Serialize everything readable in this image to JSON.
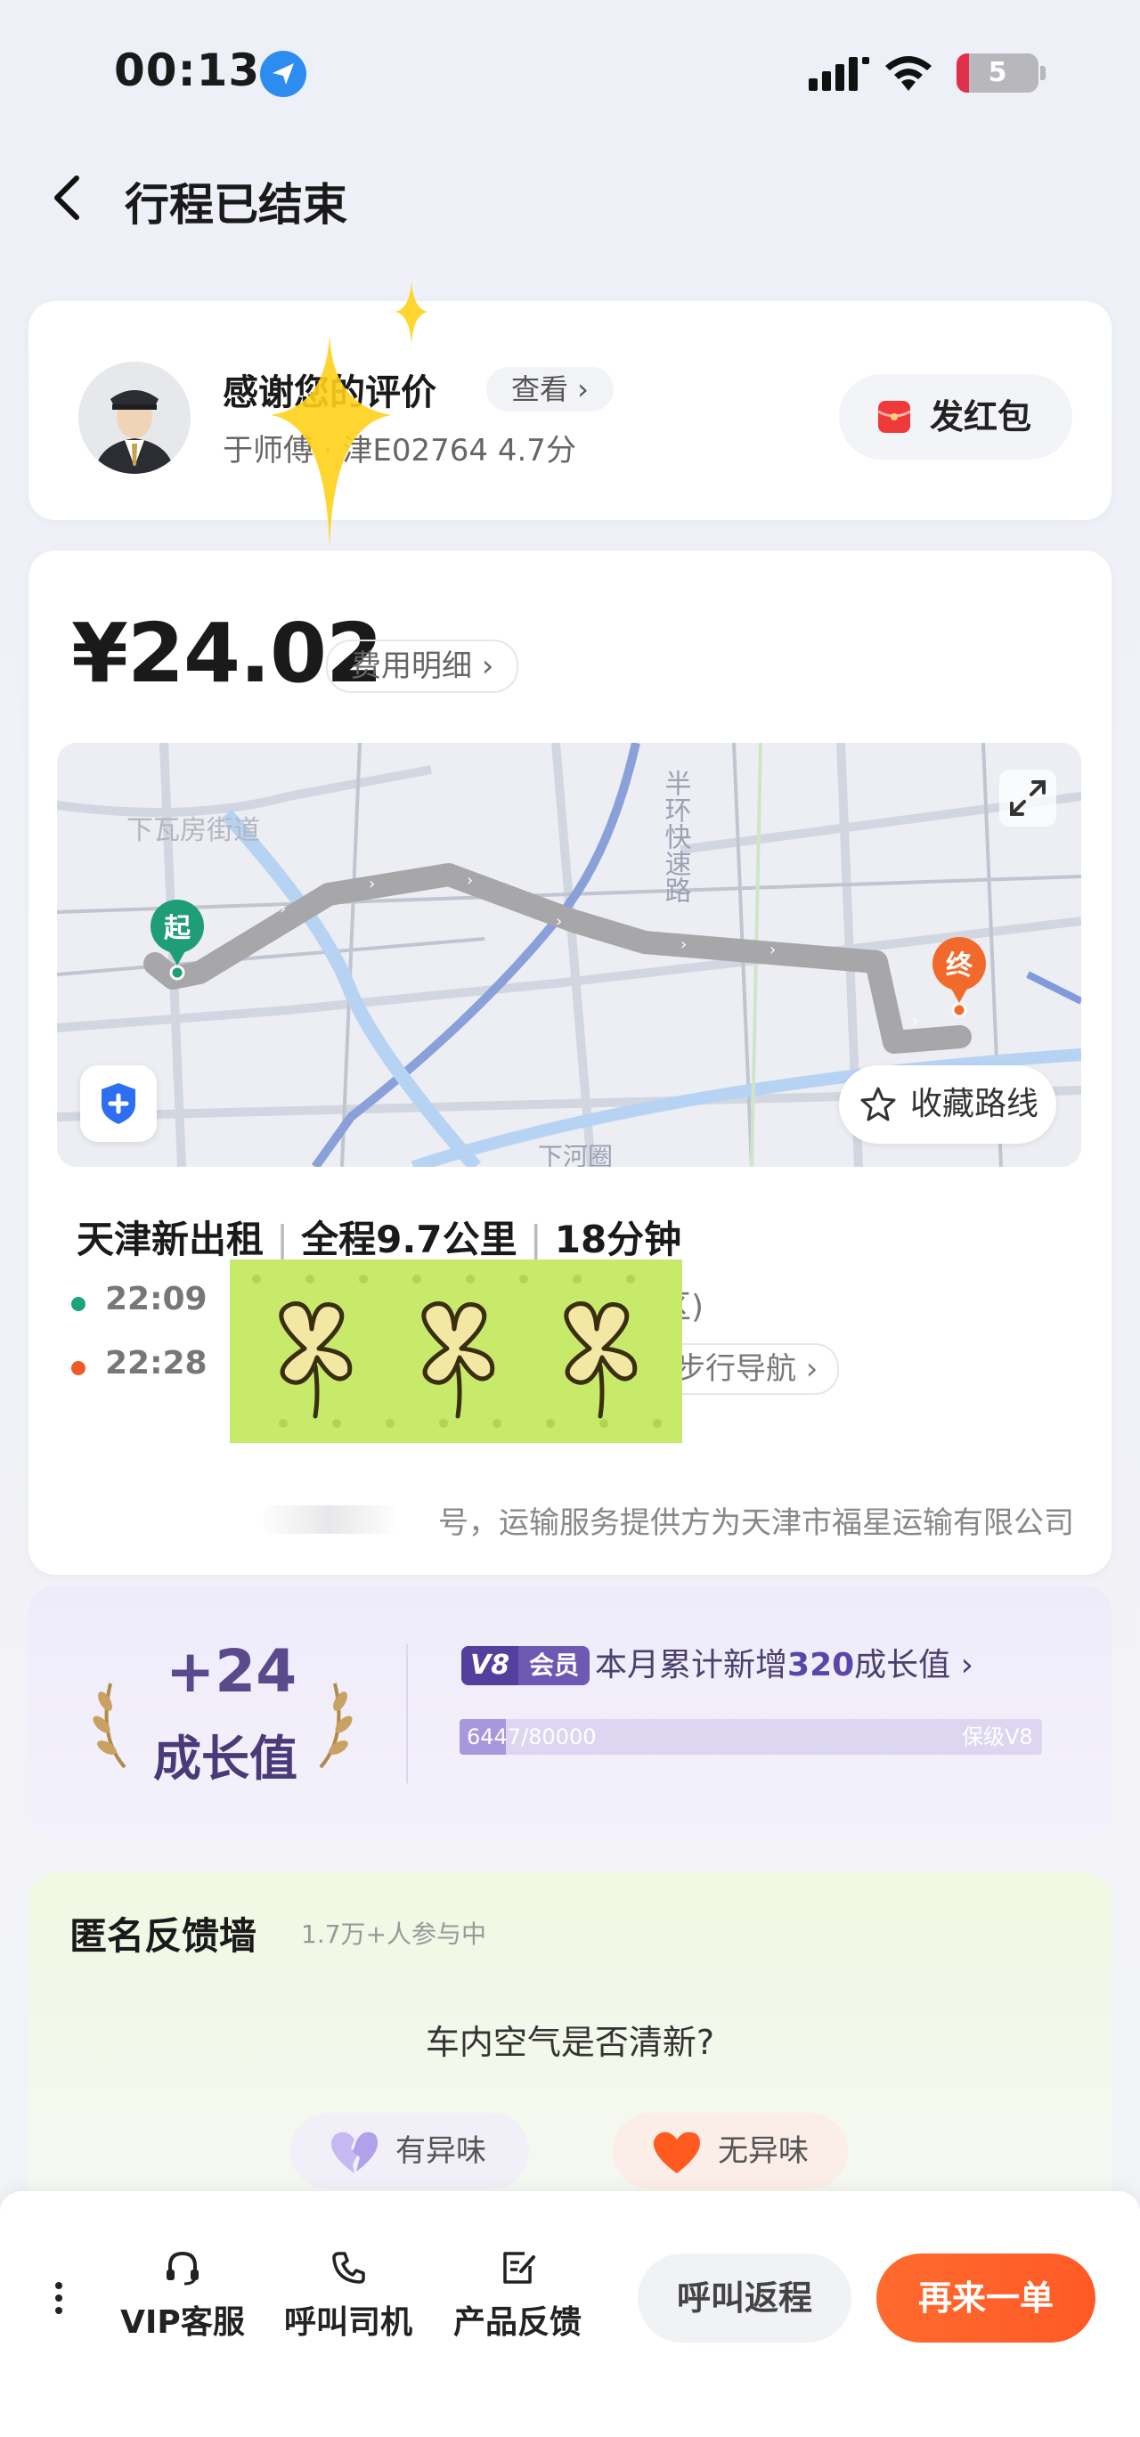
{
  "status_bar": {
    "time": "00:13",
    "battery": "5"
  },
  "nav": {
    "title": "行程已结束"
  },
  "driver": {
    "thanks": "感谢您的评价",
    "view_label": "查看 ›",
    "info": "于师傅 · 津E02764 4.7分",
    "redpack_label": "发红包"
  },
  "trip": {
    "price": "¥24.02",
    "fee_detail_label": "费用明细 ›",
    "map": {
      "start_marker": "起",
      "end_marker": "终",
      "save_route_label": "收藏路线",
      "road_label_1": "下瓦房街道",
      "road_label_2": "半环快速路",
      "road_label_3": "下河圈"
    },
    "service": "天津新出租",
    "distance": "全程9.7公里",
    "duration": "18分钟",
    "start_time": "22:09",
    "start_addr_tail": "区)",
    "end_time": "22:28",
    "nav_label": "步行导航 ›",
    "provider": "号，运输服务提供方为天津市福星运输有限公司"
  },
  "growth": {
    "value": "+24",
    "label": "成长值",
    "level": "V8",
    "member_label": "会员",
    "month_prefix": "本月累计新增",
    "month_value": "320",
    "month_suffix": "成长值 ›",
    "progress_text": "6447/80000",
    "progress_fraction": 0.08,
    "progress_target": "保级V8"
  },
  "feedback": {
    "title": "匿名反馈墙",
    "count": "1.7万+人参与中",
    "question": "车内空气是否清新?",
    "option_1": "有异味",
    "option_2": "无异味"
  },
  "bottom": {
    "vip_service": "VIP客服",
    "call_driver": "呼叫司机",
    "product_feedback": "产品反馈",
    "return_trip": "呼叫返程",
    "order_again": "再来一单"
  },
  "colors": {
    "accent_orange": "#ff5f2a",
    "start_green": "#1da37a",
    "vip_purple": "#6f58b4"
  }
}
